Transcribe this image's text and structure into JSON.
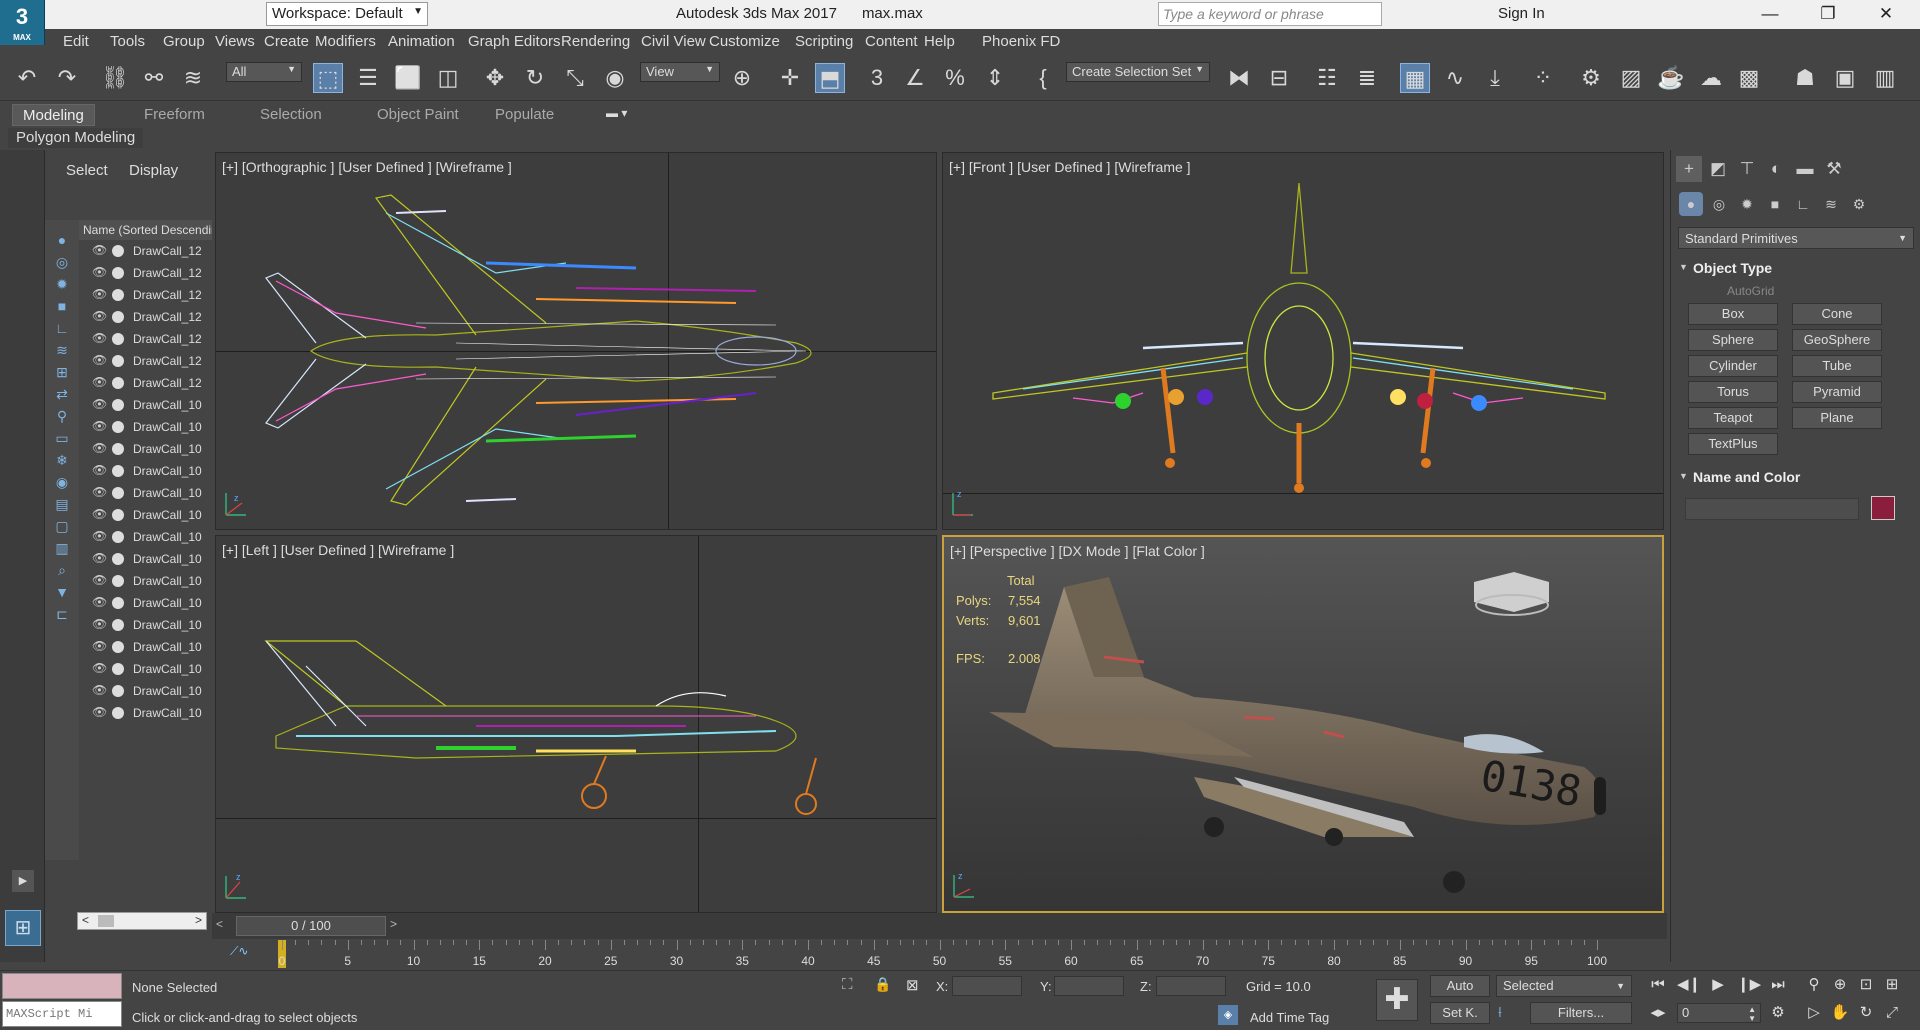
{
  "app": {
    "logo_text": "3",
    "logo_sub": "MAX",
    "workspace": "Workspace: Default",
    "title": "Autodesk 3ds Max 2017      max.max",
    "search_placeholder": "Type a keyword or phrase",
    "sign_in": "Sign In"
  },
  "menu": [
    "Edit",
    "Tools",
    "Group",
    "Views",
    "Create",
    "Modifiers",
    "Animation",
    "Graph Editors",
    "Rendering",
    "Civil View",
    "Customize",
    "Scripting",
    "Content",
    "Help",
    "Phoenix FD"
  ],
  "toolbar": {
    "filter": "All",
    "ref_coord": "View",
    "selection_set": "Create Selection Set"
  },
  "ribbon": {
    "tabs": [
      "Modeling",
      "Freeform",
      "Selection",
      "Object Paint",
      "Populate"
    ],
    "active": "Modeling",
    "panel": "Polygon Modeling"
  },
  "explorer": {
    "tabs": [
      "Select",
      "Display"
    ],
    "column_header": "Name (Sorted Descending)",
    "rows": [
      "DrawCall_12",
      "DrawCall_12",
      "DrawCall_12",
      "DrawCall_12",
      "DrawCall_12",
      "DrawCall_12",
      "DrawCall_12",
      "DrawCall_10",
      "DrawCall_10",
      "DrawCall_10",
      "DrawCall_10",
      "DrawCall_10",
      "DrawCall_10",
      "DrawCall_10",
      "DrawCall_10",
      "DrawCall_10",
      "DrawCall_10",
      "DrawCall_10",
      "DrawCall_10",
      "DrawCall_10",
      "DrawCall_10",
      "DrawCall_10"
    ]
  },
  "viewports": {
    "top_left": "[+] [Orthographic ] [User Defined ] [Wireframe ]",
    "top_right": "[+] [Front ] [User Defined ] [Wireframe ]",
    "bottom_left": "[+] [Left ] [User Defined ] [Wireframe ]",
    "bottom_right": "[+] [Perspective ] [DX Mode ] [Flat Color ]"
  },
  "stats": {
    "total_label": "Total",
    "polys_label": "Polys:",
    "polys": "7,554",
    "verts_label": "Verts:",
    "verts": "9,601",
    "fps_label": "FPS:",
    "fps": "2.008",
    "tail_number": "0138"
  },
  "command_panel": {
    "category": "Standard Primitives",
    "object_type_title": "Object Type",
    "autogrid": "AutoGrid",
    "buttons": [
      "Box",
      "Cone",
      "Sphere",
      "GeoSphere",
      "Cylinder",
      "Tube",
      "Torus",
      "Pyramid",
      "Teapot",
      "Plane",
      "TextPlus"
    ],
    "name_color_title": "Name and Color",
    "object_color": "#8a1e3c"
  },
  "timeline": {
    "frame_display": "0 / 100",
    "ticks": [
      "0",
      "5",
      "10",
      "15",
      "20",
      "25",
      "30",
      "35",
      "40",
      "45",
      "50",
      "55",
      "60",
      "65",
      "70",
      "75",
      "80",
      "85",
      "90",
      "95",
      "100"
    ]
  },
  "status": {
    "maxscript_text": "MAXScript Mi",
    "selection": "None Selected",
    "prompt": "Click or click-and-drag to select objects",
    "x_label": "X:",
    "y_label": "Y:",
    "z_label": "Z:",
    "grid": "Grid = 10.0",
    "add_time_tag": "Add Time Tag",
    "auto": "Auto",
    "selected": "Selected",
    "set_key": "Set K.",
    "filters": "Filters...",
    "frame": "0"
  }
}
